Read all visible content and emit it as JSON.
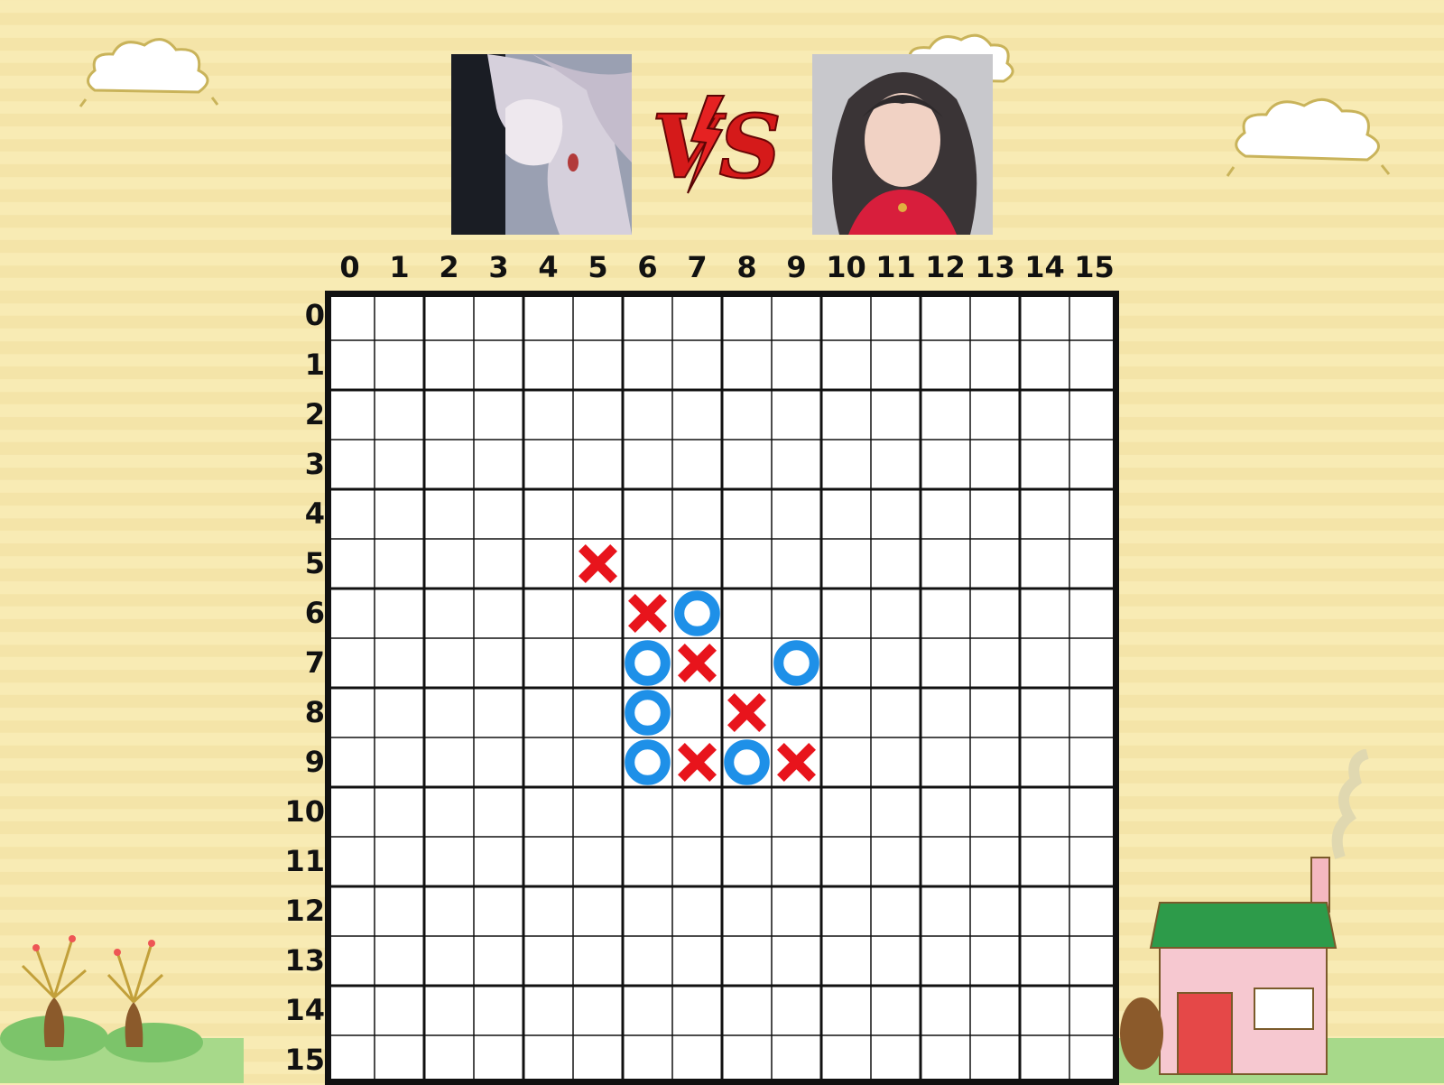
{
  "players": {
    "left": {
      "avatar_icon": "anime-girl-avatar",
      "symbol": "O"
    },
    "right": {
      "avatar_icon": "girl-selfie-avatar",
      "symbol": "X"
    }
  },
  "versus_label": "VS",
  "board": {
    "columns": [
      "0",
      "1",
      "2",
      "3",
      "4",
      "5",
      "6",
      "7",
      "8",
      "9",
      "10",
      "11",
      "12",
      "13",
      "14",
      "15"
    ],
    "rows": [
      "0",
      "1",
      "2",
      "3",
      "4",
      "5",
      "6",
      "7",
      "8",
      "9",
      "10",
      "11",
      "12",
      "13",
      "14",
      "15"
    ],
    "pieces": [
      {
        "row": 5,
        "col": 5,
        "mark": "X"
      },
      {
        "row": 6,
        "col": 6,
        "mark": "X"
      },
      {
        "row": 6,
        "col": 7,
        "mark": "O"
      },
      {
        "row": 7,
        "col": 6,
        "mark": "O"
      },
      {
        "row": 7,
        "col": 7,
        "mark": "X"
      },
      {
        "row": 7,
        "col": 9,
        "mark": "O"
      },
      {
        "row": 8,
        "col": 6,
        "mark": "O"
      },
      {
        "row": 8,
        "col": 8,
        "mark": "X"
      },
      {
        "row": 9,
        "col": 6,
        "mark": "O"
      },
      {
        "row": 9,
        "col": 7,
        "mark": "X"
      },
      {
        "row": 9,
        "col": 8,
        "mark": "O"
      },
      {
        "row": 9,
        "col": 9,
        "mark": "X"
      }
    ]
  },
  "colors": {
    "x_mark": "#e8141c",
    "o_mark": "#1e90e8",
    "grid": "#111111",
    "background": "#f8ebb4"
  }
}
